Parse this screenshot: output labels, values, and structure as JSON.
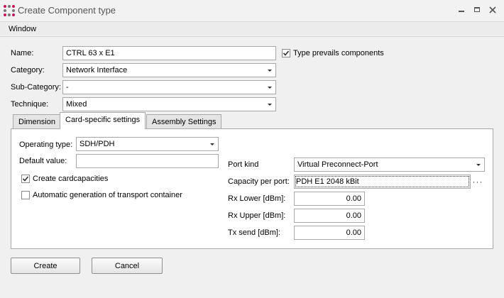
{
  "window": {
    "title": "Create Component type",
    "menu_window": "Window",
    "minimize_glyph": "‒",
    "maximize_glyph": "▭",
    "close_glyph": "✕"
  },
  "form": {
    "name_label": "Name:",
    "name_value": "CTRL 63 x E1",
    "type_prevails_label": "Type prevails components",
    "type_prevails_checked": true,
    "category_label": "Category:",
    "category_value": "Network Interface",
    "subcategory_label": "Sub-Category:",
    "subcategory_value": "-",
    "technique_label": "Technique:",
    "technique_value": "Mixed"
  },
  "tabs": [
    {
      "label": "Dimension",
      "active": false
    },
    {
      "label": "Card-specific settings",
      "active": true
    },
    {
      "label": "Assembly Settings",
      "active": false
    }
  ],
  "card": {
    "operating_type_label": "Operating type:",
    "operating_type_value": "SDH/PDH",
    "default_value_label": "Default value:",
    "default_value": "",
    "create_cardcapacities_label": "Create cardcapacities",
    "create_cardcapacities_checked": true,
    "auto_transport_label": "Automatic generation of transport container",
    "auto_transport_checked": false,
    "port_kind_label": "Port kind",
    "port_kind_value": "Virtual Preconnect-Port",
    "capacity_per_port_label": "Capacity per port:",
    "capacity_per_port_value": "PDH E1 2048 kBit",
    "rx_lower_label": "Rx Lower [dBm]:",
    "rx_lower_value": "0.00",
    "rx_upper_label": "Rx Upper [dBm]:",
    "rx_upper_value": "0.00",
    "tx_send_label": "Tx send [dBm]:",
    "tx_send_value": "0.00"
  },
  "buttons": {
    "create": "Create",
    "cancel": "Cancel",
    "browse": "···"
  },
  "colors": {
    "window_bg": "#f0f0f0",
    "app_icon": "#c2185b"
  }
}
